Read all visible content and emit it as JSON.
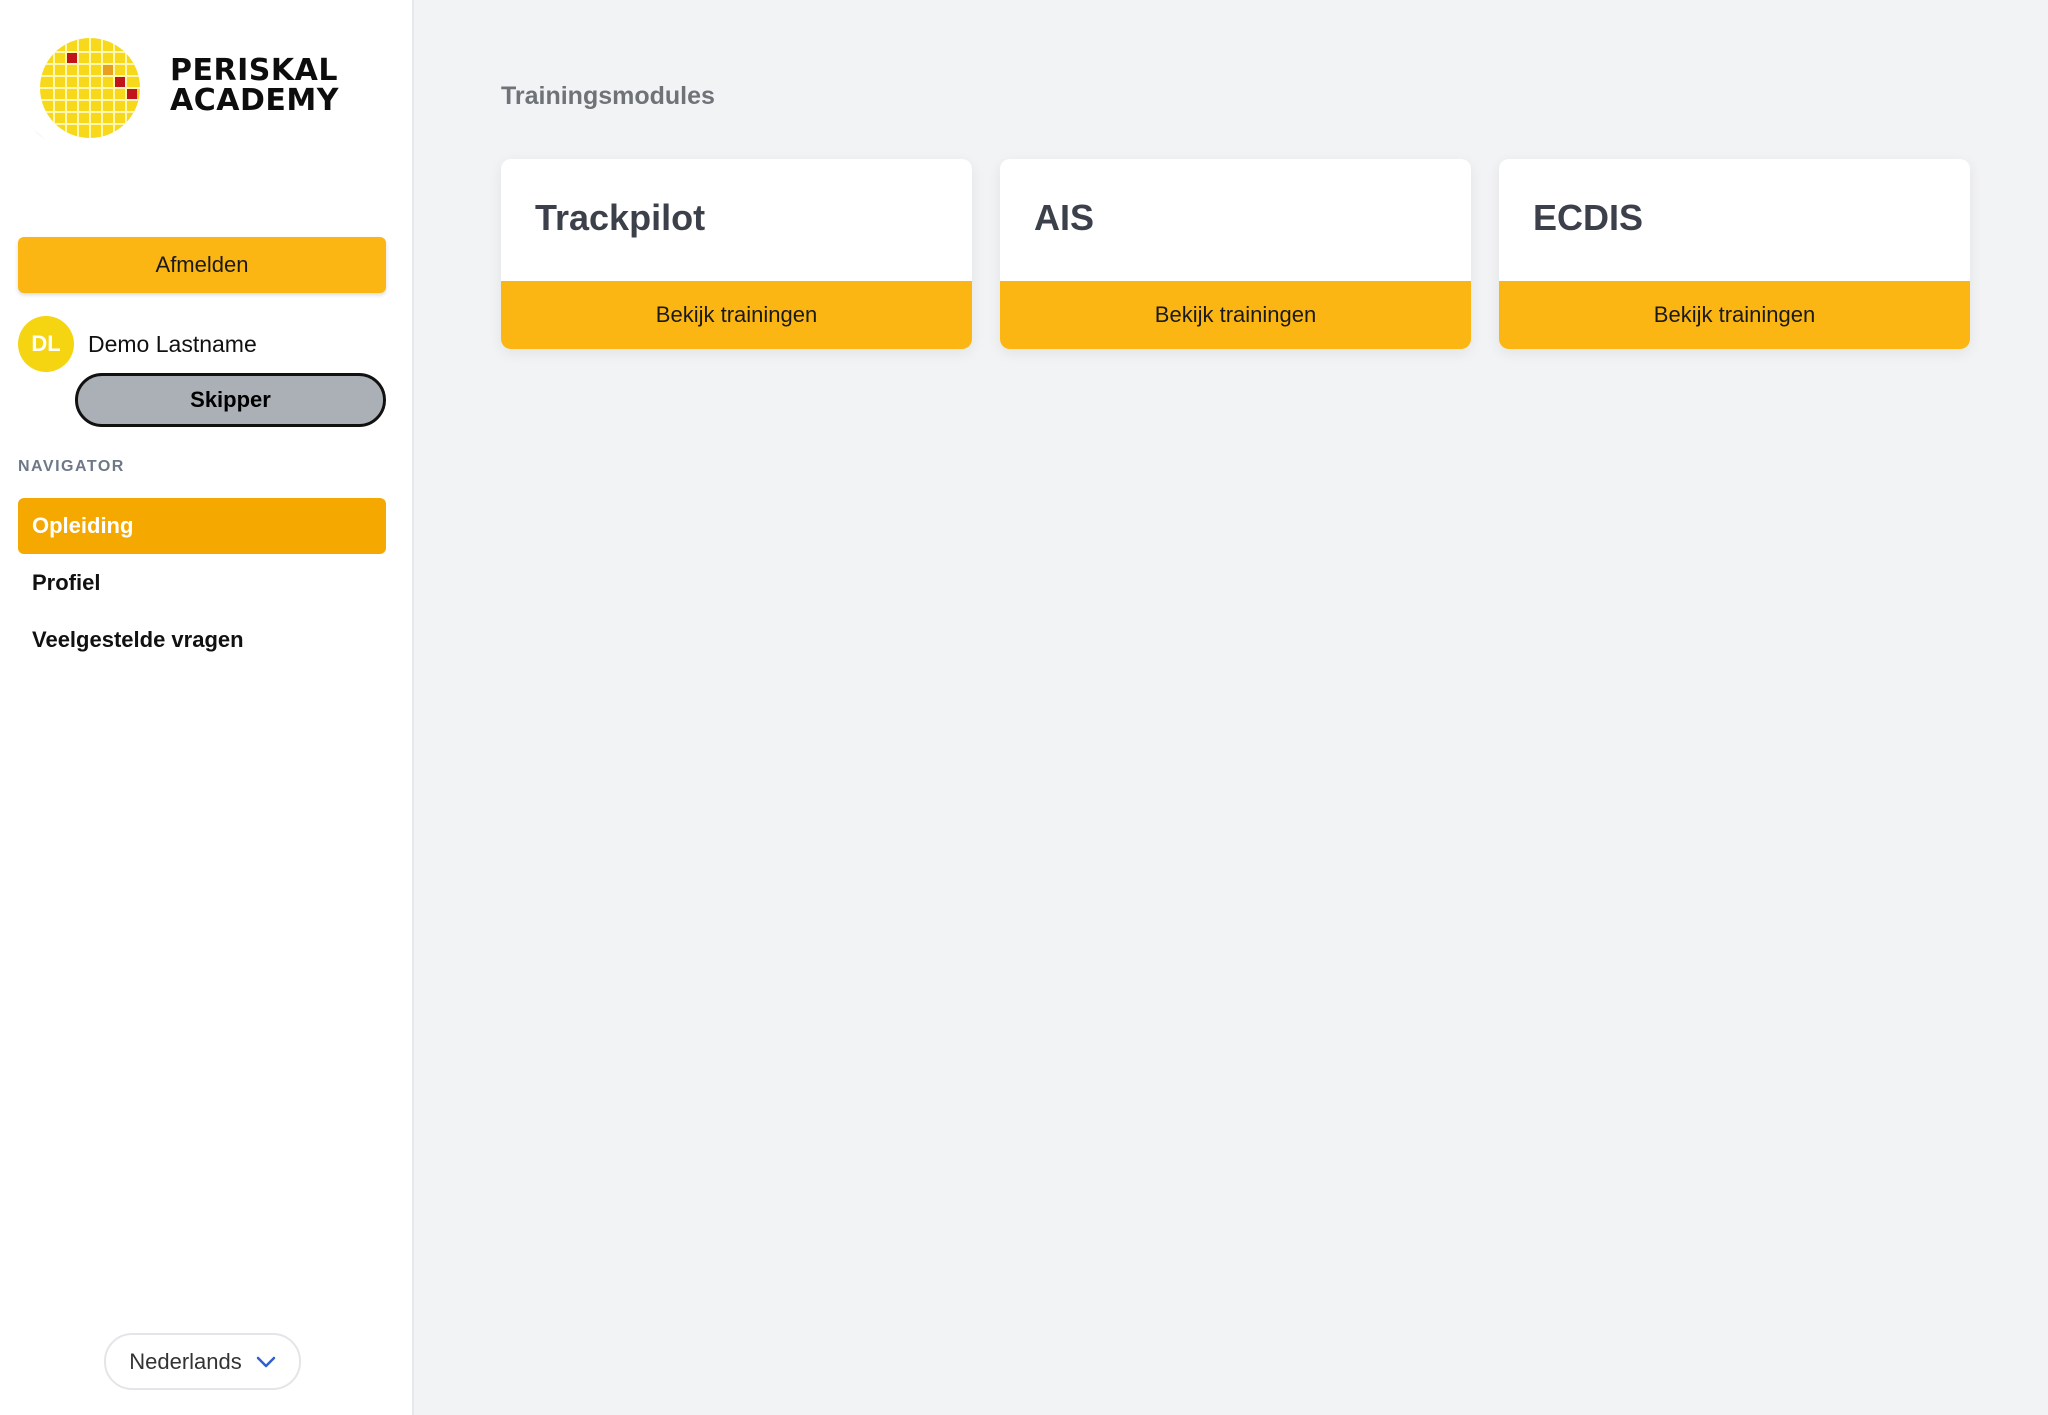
{
  "brand": {
    "line1": "PERISKAL",
    "line2": "ACADEMY"
  },
  "sidebar": {
    "logout_label": "Afmelden",
    "user": {
      "initials": "DL",
      "name": "Demo Lastname",
      "role": "Skipper"
    },
    "nav_heading": "NAVIGATOR",
    "nav_items": [
      {
        "label": "Opleiding",
        "active": true
      },
      {
        "label": "Profiel",
        "active": false
      },
      {
        "label": "Veelgestelde vragen",
        "active": false
      }
    ],
    "language": {
      "selected": "Nederlands",
      "icon": "chevron-down-icon"
    }
  },
  "main": {
    "title": "Trainingsmodules",
    "modules": [
      {
        "title": "Trackpilot",
        "button_label": "Bekijk trainingen"
      },
      {
        "title": "AIS",
        "button_label": "Bekijk trainingen"
      },
      {
        "title": "ECDIS",
        "button_label": "Bekijk trainingen"
      }
    ]
  },
  "colors": {
    "accent": "#fbb613",
    "active_nav": "#f5a900",
    "avatar": "#f5d511",
    "role_badge": "#abb0b7",
    "background": "#f2f3f5"
  }
}
